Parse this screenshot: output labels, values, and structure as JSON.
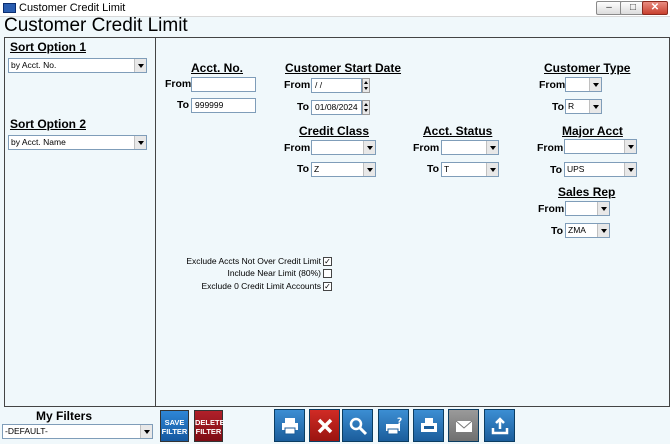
{
  "window": {
    "title": "Customer Credit Limit",
    "controls": [
      "–",
      "□",
      "✕"
    ]
  },
  "form_title": "Customer Credit Limit",
  "sort": {
    "option1_label": "Sort Option 1",
    "option1_value": "by Acct. No.",
    "option2_label": "Sort Option 2",
    "option2_value": "by Acct. Name"
  },
  "acct_no": {
    "title": "Acct. No.",
    "from_label": "From",
    "from_value": "",
    "to_label": "To",
    "to_value": "999999"
  },
  "start_date": {
    "title": "Customer Start Date",
    "from_label": "From",
    "from_value": " / /",
    "to_label": "To",
    "to_value": "01/08/2024"
  },
  "customer_type": {
    "title": "Customer Type",
    "from_label": "From",
    "from_value": "",
    "to_label": "To",
    "to_value": "R"
  },
  "credit_class": {
    "title": "Credit Class",
    "from_label": "From",
    "from_value": "",
    "to_label": "To",
    "to_value": "Z"
  },
  "acct_status": {
    "title": "Acct. Status",
    "from_label": "From",
    "from_value": "",
    "to_label": "To",
    "to_value": "T"
  },
  "major_acct": {
    "title": "Major Acct",
    "from_label": "From",
    "from_value": "",
    "to_label": "To",
    "to_value": "UPS"
  },
  "sales_rep": {
    "title": "Sales Rep",
    "from_label": "From",
    "from_value": "",
    "to_label": "To",
    "to_value": "ZMA"
  },
  "options": [
    {
      "label": "Exclude Accts Not Over Credit Limit",
      "checked": true,
      "mark": "✓"
    },
    {
      "label": "Include Near Limit (80%)",
      "checked": false,
      "mark": ""
    },
    {
      "label": "Exclude 0 Credit Limit Accounts",
      "checked": true,
      "mark": "✓"
    }
  ],
  "filters": {
    "label": "My Filters",
    "value": "-DEFAULT-",
    "save_label": "SAVE FILTER",
    "delete_label": "DELETE FILTER"
  },
  "toolbar_icons": [
    "print-icon",
    "cancel-icon",
    "search-icon",
    "print-help-icon",
    "fax-icon",
    "email-icon",
    "export-icon"
  ],
  "colors": {
    "background": "#f0f8fb",
    "toolbar_blue": "#2a72b5",
    "delete_red": "#a0101a",
    "save_blue": "#1e6fc0"
  }
}
